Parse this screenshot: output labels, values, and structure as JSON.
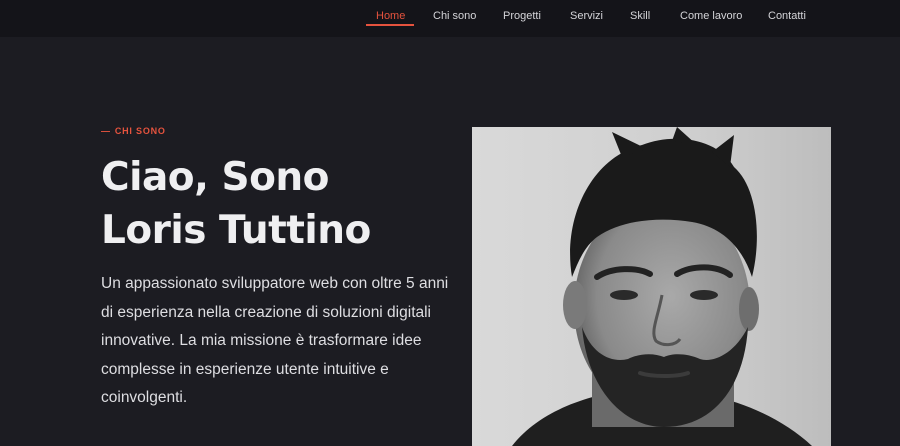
{
  "nav": {
    "items": [
      "Home",
      "Chi sono",
      "Progetti",
      "Servizi",
      "Skill",
      "Come lavoro",
      "Contatti"
    ],
    "active": "Home",
    "accent": "#e5533e"
  },
  "hero": {
    "eyebrow_dash": "—",
    "eyebrow": "CHI SONO",
    "title_line1": "Ciao, Sono",
    "title_line2": "Loris Tuttino",
    "bio": "Un appassionato sviluppatore web con oltre 5 anni di esperienza nella creazione di soluzioni digitali innovative. La mia missione è trasformare idee complesse in esperienze utente intuitive e coinvolgenti."
  },
  "colors": {
    "background": "#1c1c22",
    "navbar": "#141419",
    "accent": "#e5533e"
  }
}
